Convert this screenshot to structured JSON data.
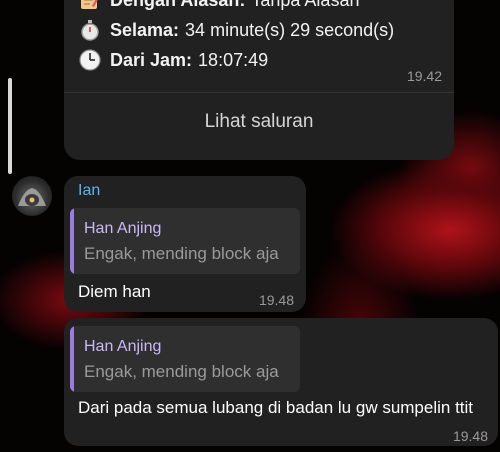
{
  "channel_message": {
    "rows": [
      {
        "icon": "memo-icon",
        "label": "Dengan Alasan:",
        "value": "Tanpa Alasan"
      },
      {
        "icon": "stopwatch-icon",
        "label": "Selama:",
        "value": "34 minute(s) 29 second(s)"
      },
      {
        "icon": "clock-icon",
        "label": "Dari Jam:",
        "value": "18:07:49"
      }
    ],
    "time": "19.42",
    "view_channel_label": "Lihat saluran"
  },
  "message1": {
    "sender": "Ian",
    "reply": {
      "name": "Han Anjing",
      "text": "Engak, mending block aja"
    },
    "text": "Diem han",
    "time": "19.48"
  },
  "message2": {
    "reply": {
      "name": "Han Anjing",
      "text": "Engak, mending block aja"
    },
    "text": "Dari pada semua lubang di badan lu gw sumpelin ttit",
    "time": "19.48"
  },
  "colors": {
    "bubble": "#212121",
    "sender": "#5fb4ea",
    "reply_bar": "#9c7be0",
    "reply_name": "#c9b9f5"
  }
}
